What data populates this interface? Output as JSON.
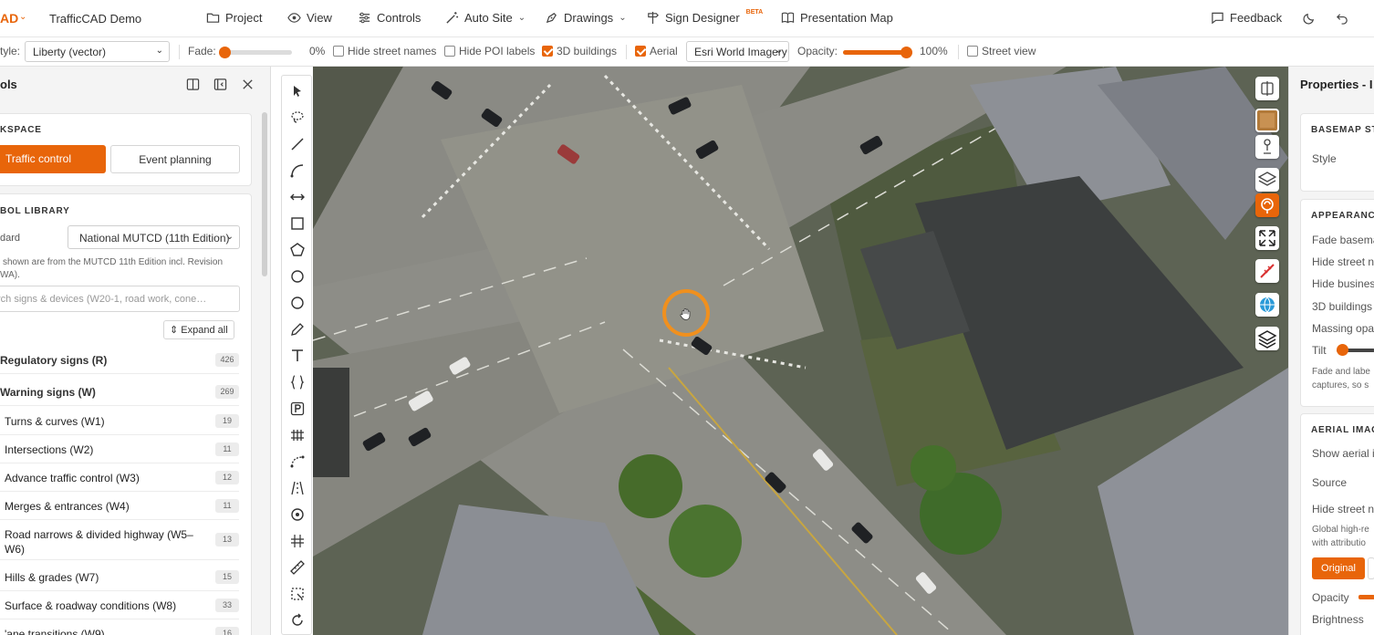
{
  "app": {
    "brand": "AD",
    "project_name": "TrafficCAD Demo"
  },
  "nav": {
    "project": "Project",
    "view": "View",
    "controls": "Controls",
    "auto_site": "Auto Site",
    "drawings": "Drawings",
    "sign_designer": "Sign Designer",
    "sign_designer_badge": "BETA",
    "presentation_map": "Presentation Map",
    "feedback": "Feedback"
  },
  "toolbar": {
    "style_label": "tyle:",
    "style_value": "Liberty (vector)",
    "fade_label": "Fade:",
    "fade_value": "0%",
    "fade_level": 0,
    "hide_street_names": {
      "label": "Hide street names",
      "checked": false
    },
    "hide_poi_labels": {
      "label": "Hide POI labels",
      "checked": false
    },
    "buildings_3d": {
      "label": "3D buildings",
      "checked": true
    },
    "aerial": {
      "label": "Aerial",
      "checked": true
    },
    "imagery_source": "Esri World Imagery",
    "opacity_label": "Opacity:",
    "opacity_value": "100%",
    "opacity_level": 100,
    "street_view": {
      "label": "Street view",
      "checked": false
    }
  },
  "left_panel": {
    "title": "ols",
    "workspace": {
      "heading": "KSPACE",
      "traffic_control": "Traffic control",
      "event_planning": "Event planning"
    },
    "symbol_library": {
      "heading": "BOL LIBRARY",
      "standard_label": "dard",
      "standard_value": "National MUTCD (11th Edition)",
      "note_line1": "shown are from the MUTCD 11th Edition incl. Revision",
      "note_line2": "WA).",
      "search_placeholder": "rch signs & devices (W20-1, road work, cone…",
      "expand_all": "Expand all"
    },
    "categories": [
      {
        "label": "Regulatory signs (R)",
        "count": "426",
        "level": "top"
      },
      {
        "label": "Warning signs (W)",
        "count": "269",
        "level": "top"
      },
      {
        "label": "Turns & curves (W1)",
        "count": "19",
        "level": "sub"
      },
      {
        "label": "Intersections (W2)",
        "count": "11",
        "level": "sub"
      },
      {
        "label": "Advance traffic control (W3)",
        "count": "12",
        "level": "sub"
      },
      {
        "label": "Merges & entrances (W4)",
        "count": "11",
        "level": "sub"
      },
      {
        "label": "Road narrows & divided highway (W5–",
        "label2": "W6)",
        "count": "13",
        "level": "sub"
      },
      {
        "label": "Hills & grades (W7)",
        "count": "15",
        "level": "sub"
      },
      {
        "label": "Surface & roadway conditions (W8)",
        "count": "33",
        "level": "sub"
      },
      {
        "label": "'ane transitions (W9)",
        "count": "16",
        "level": "sub"
      }
    ]
  },
  "right_panel": {
    "title": "Properties - I",
    "basemap": {
      "heading": "BASEMAP ST",
      "style": "Style"
    },
    "appearance": {
      "heading": "APPEARANC",
      "rows": [
        "Fade basema",
        "Hide street na",
        "Hide busines",
        "3D buildings",
        "Massing opac",
        "Tilt"
      ],
      "note_line1": "Fade and labe",
      "note_line2": "captures, so s"
    },
    "aerial_imagery": {
      "heading": "AERIAL IMAG",
      "show": "Show aerial i",
      "source": "Source",
      "hide_street": "Hide street na",
      "note_line1": "Global high-re",
      "note_line2": "with attributio",
      "original_button": "Original",
      "opacity": "Opacity",
      "brightness": "Brightness"
    }
  },
  "colors": {
    "accent": "#e8650a",
    "cursor_ring": "#f0901e"
  }
}
